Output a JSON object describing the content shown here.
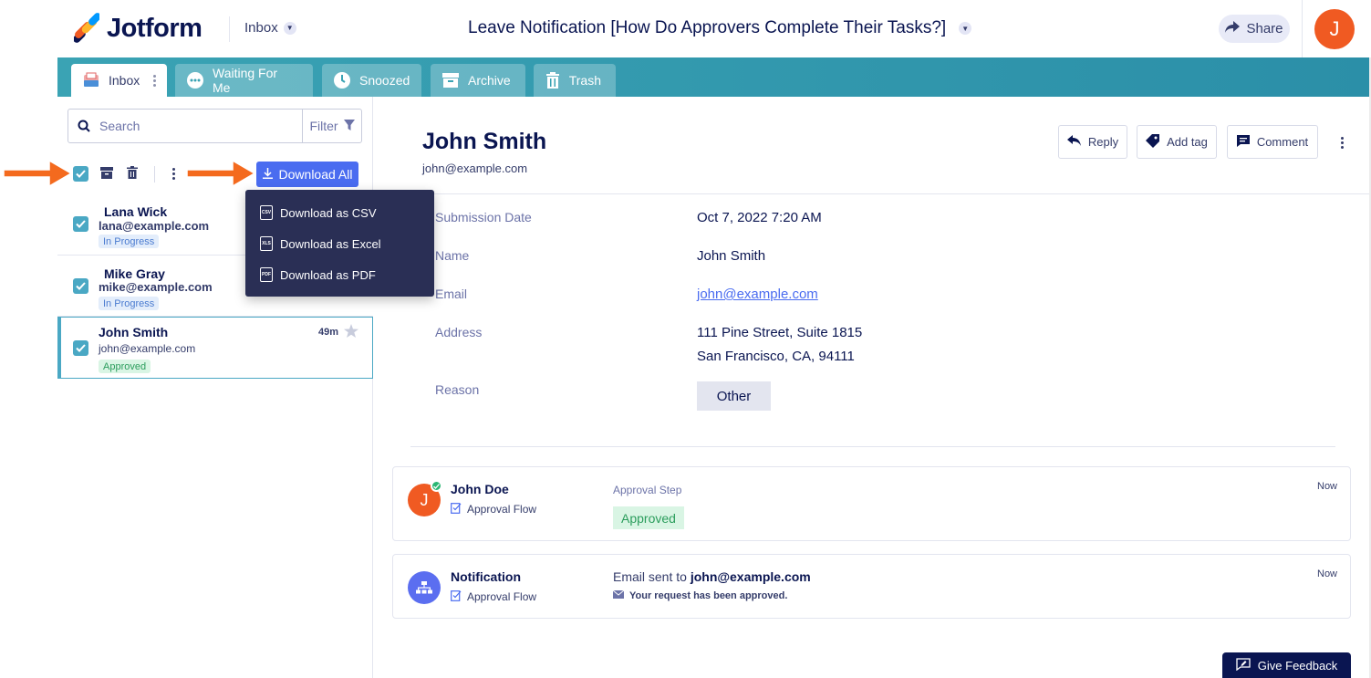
{
  "header": {
    "brand": "Jotform",
    "inbox_label": "Inbox",
    "title": "Leave Notification [How Do Approvers Complete Their Tasks?]",
    "share_label": "Share",
    "avatar_initial": "J"
  },
  "tabs": [
    {
      "label": "Inbox",
      "icon": "inbox-icon"
    },
    {
      "label": "Waiting For Me",
      "icon": "ellipsis-circle-icon"
    },
    {
      "label": "Snoozed",
      "icon": "clock-icon"
    },
    {
      "label": "Archive",
      "icon": "archive-icon"
    },
    {
      "label": "Trash",
      "icon": "trash-icon"
    }
  ],
  "sidebar": {
    "search_placeholder": "Search",
    "filter_label": "Filter",
    "download_all_label": "Download All",
    "download_menu": [
      {
        "label": "Download as CSV",
        "icon": "CSV"
      },
      {
        "label": "Download as Excel",
        "icon": "XLS"
      },
      {
        "label": "Download as PDF",
        "icon": "PDF"
      }
    ],
    "items": [
      {
        "name": "Lana Wick",
        "email": "lana@example.com",
        "status": "In Progress"
      },
      {
        "name": "Mike Gray",
        "email": "mike@example.com",
        "status": "In Progress"
      },
      {
        "name": "John Smith",
        "email": "john@example.com",
        "status": "Approved",
        "time": "49m"
      }
    ]
  },
  "submission": {
    "name": "John Smith",
    "email": "john@example.com",
    "actions": {
      "reply": "Reply",
      "add_tag": "Add tag",
      "comment": "Comment"
    },
    "fields": [
      {
        "label": "Submission Date",
        "value": "Oct 7, 2022 7:20 AM"
      },
      {
        "label": "Name",
        "value": "John Smith"
      },
      {
        "label": "Email",
        "value": "john@example.com"
      },
      {
        "label": "Address",
        "value": "111 Pine Street, Suite 1815",
        "value2": "San Francisco, CA, 94111"
      },
      {
        "label": "Reason",
        "value": "Other"
      }
    ]
  },
  "timeline": [
    {
      "avatar": "J",
      "title": "John Doe",
      "subtitle": "Approval Flow",
      "step_label": "Approval Step",
      "status": "Approved",
      "time": "Now"
    },
    {
      "title": "Notification",
      "subtitle": "Approval Flow",
      "line_prefix": "Email sent to",
      "line_email": "john@example.com",
      "message": "Your request has been approved.",
      "time": "Now"
    }
  ],
  "feedback_label": "Give Feedback",
  "colors": {
    "accent": "#4a6cf0",
    "teal": "#3aa3b4",
    "navy": "#0a1551",
    "orange": "#f05a22",
    "approved": "#2b9d5c"
  }
}
